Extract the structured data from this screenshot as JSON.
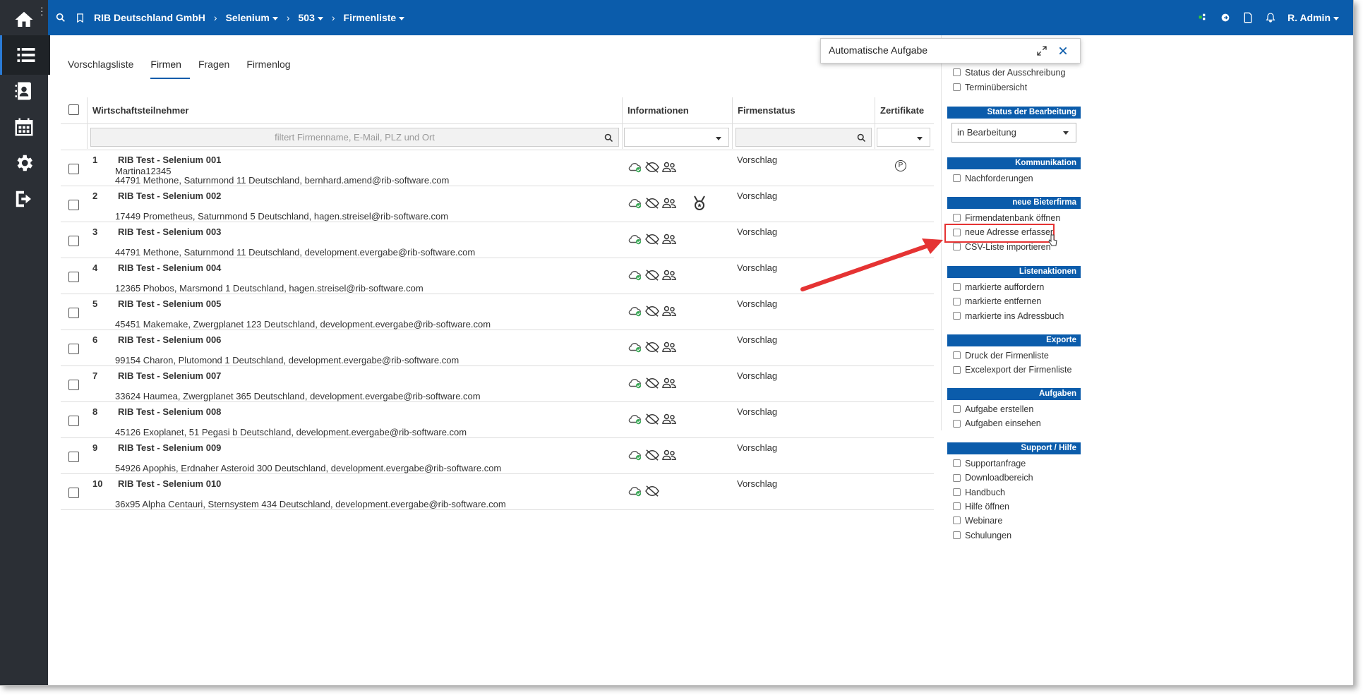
{
  "topbar": {
    "company": "RIB Deutschland GmbH",
    "project": "Selenium",
    "number": "503",
    "page": "Firmenliste",
    "user": "R. Admin"
  },
  "tabs": [
    "Vorschlagsliste",
    "Firmen",
    "Fragen",
    "Firmenlog"
  ],
  "table": {
    "headers": {
      "participant": "Wirtschaftsteilnehmer",
      "info": "Informationen",
      "status": "Firmenstatus",
      "cert": "Zertifikate"
    },
    "filter_placeholder": "filtert Firmenname, E-Mail, PLZ und Ort",
    "rows": [
      {
        "num": "1",
        "name": "RIB Test - Selenium 001",
        "sub": "Martina12345",
        "addr": "44791 Methone, Saturnmond 11 Deutschland, bernhard.amend@rib-software.com",
        "status": "Vorschlag",
        "cert": "P",
        "medal": false,
        "people": true
      },
      {
        "num": "2",
        "name": "RIB Test - Selenium 002",
        "sub": "",
        "addr": "17449 Prometheus, Saturnmond 5 Deutschland, hagen.streisel@rib-software.com",
        "status": "Vorschlag",
        "cert": "",
        "medal": true,
        "people": true
      },
      {
        "num": "3",
        "name": "RIB Test - Selenium 003",
        "sub": "",
        "addr": "44791 Methone, Saturnmond 11 Deutschland, development.evergabe@rib-software.com",
        "status": "Vorschlag",
        "cert": "",
        "medal": false,
        "people": true
      },
      {
        "num": "4",
        "name": "RIB Test - Selenium 004",
        "sub": "",
        "addr": "12365 Phobos, Marsmond 1 Deutschland, hagen.streisel@rib-software.com",
        "status": "Vorschlag",
        "cert": "",
        "medal": false,
        "people": true
      },
      {
        "num": "5",
        "name": "RIB Test - Selenium 005",
        "sub": "",
        "addr": "45451 Makemake, Zwergplanet 123 Deutschland, development.evergabe@rib-software.com",
        "status": "Vorschlag",
        "cert": "",
        "medal": false,
        "people": true
      },
      {
        "num": "6",
        "name": "RIB Test - Selenium 006",
        "sub": "",
        "addr": "99154 Charon, Plutomond 1 Deutschland, development.evergabe@rib-software.com",
        "status": "Vorschlag",
        "cert": "",
        "medal": false,
        "people": true
      },
      {
        "num": "7",
        "name": "RIB Test - Selenium 007",
        "sub": "",
        "addr": "33624 Haumea, Zwergplanet 365 Deutschland, development.evergabe@rib-software.com",
        "status": "Vorschlag",
        "cert": "",
        "medal": false,
        "people": true
      },
      {
        "num": "8",
        "name": "RIB Test - Selenium 008",
        "sub": "",
        "addr": "45126 Exoplanet, 51 Pegasi b Deutschland, development.evergabe@rib-software.com",
        "status": "Vorschlag",
        "cert": "",
        "medal": false,
        "people": true
      },
      {
        "num": "9",
        "name": "RIB Test - Selenium 009",
        "sub": "",
        "addr": "54926 Apophis, Erdnaher Asteroid 300 Deutschland, development.evergabe@rib-software.com",
        "status": "Vorschlag",
        "cert": "",
        "medal": false,
        "people": true
      },
      {
        "num": "10",
        "name": "RIB Test - Selenium 010",
        "sub": "",
        "addr": "36x95 Alpha Centauri, Sternsystem 434 Deutschland, development.evergabe@rib-software.com",
        "status": "Vorschlag",
        "cert": "",
        "medal": false,
        "people": false
      }
    ]
  },
  "popup": {
    "title": "Automatische Aufgabe"
  },
  "sidebar": {
    "top_links": [
      "Status der Ausschreibung",
      "Terminübersicht"
    ],
    "status_header": "Status der Bearbeitung",
    "status_value": "in Bearbeitung",
    "sections": [
      {
        "header": "Kommunikation",
        "items": [
          "Nachforderungen"
        ]
      },
      {
        "header": "neue Bieterfirma",
        "items": [
          "Firmendatenbank öffnen",
          "neue Adresse erfassen",
          "CSV-Liste importieren"
        ]
      },
      {
        "header": "Listenaktionen",
        "items": [
          "markierte auffordern",
          "markierte entfernen",
          "markierte ins Adressbuch"
        ]
      },
      {
        "header": "Exporte",
        "items": [
          "Druck der Firmenliste",
          "Excelexport der Firmenliste"
        ]
      },
      {
        "header": "Aufgaben",
        "items": [
          "Aufgabe erstellen",
          "Aufgaben einsehen"
        ]
      },
      {
        "header": "Support / Hilfe",
        "items": [
          "Supportanfrage",
          "Downloadbereich",
          "Handbuch",
          "Hilfe öffnen",
          "Webinare",
          "Schulungen"
        ]
      }
    ]
  },
  "colors": {
    "primary": "#0b5cab",
    "rail": "#2b2f35",
    "highlight": "#e53333"
  }
}
